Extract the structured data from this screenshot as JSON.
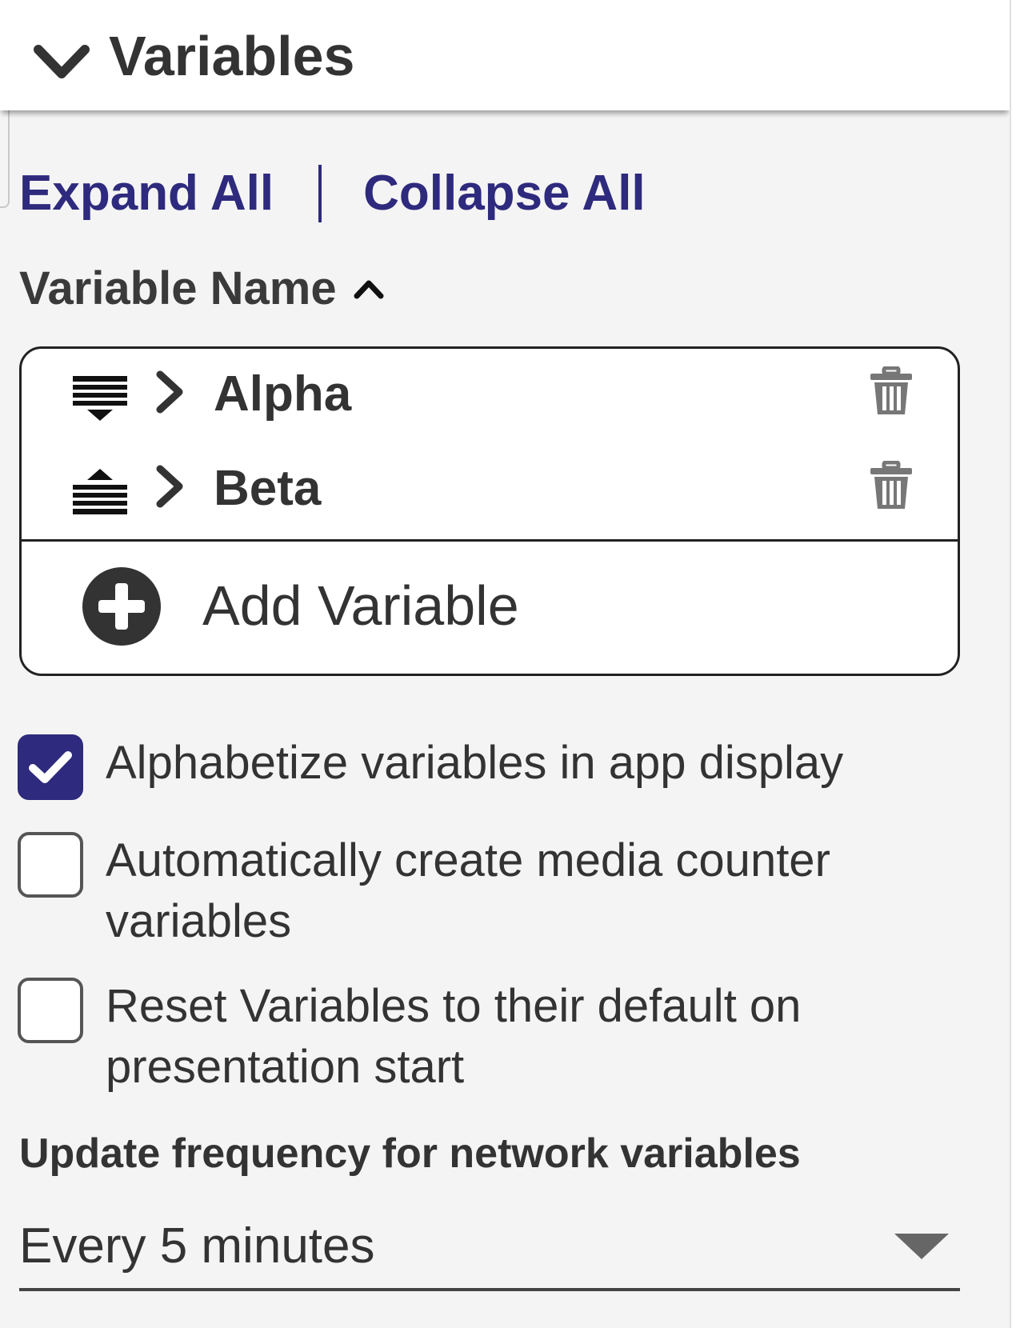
{
  "header": {
    "title": "Variables",
    "chevron_icon": "chevron-down-icon"
  },
  "links": {
    "expand_all": "Expand All",
    "collapse_all": "Collapse All"
  },
  "sort": {
    "label": "Variable Name",
    "direction_icon": "chevron-up-icon"
  },
  "variables": [
    {
      "name": "Alpha",
      "type_icon": "sort-descending-icon",
      "expand_icon": "chevron-right-icon",
      "delete_icon": "trash-icon"
    },
    {
      "name": "Beta",
      "type_icon": "sort-ascending-icon",
      "expand_icon": "chevron-right-icon",
      "delete_icon": "trash-icon"
    }
  ],
  "add_variable": {
    "label": "Add Variable",
    "icon": "plus-circle-icon"
  },
  "options": [
    {
      "label": "Alphabetize variables in app display",
      "checked": true
    },
    {
      "label": "Automatically create media counter variables",
      "checked": false
    },
    {
      "label": "Reset Variables to their default on presentation start",
      "checked": false
    }
  ],
  "update_frequency": {
    "label": "Update frequency for network variables",
    "selected": "Every 5 minutes"
  },
  "colors": {
    "accent": "#2e2a7d",
    "text": "#333333",
    "background": "#f4f4f4"
  }
}
